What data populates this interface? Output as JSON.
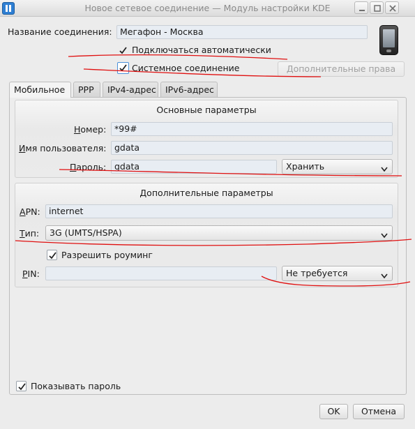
{
  "window": {
    "title": "Новое сетевое соединение — Модуль настройки KDE"
  },
  "connection": {
    "name_label": "Название соединения:",
    "name_value": "Мегафон - Москва",
    "auto_connect_label": "Подключаться автоматически",
    "auto_connect_checked": true,
    "system_connection_label": "Системное соединение",
    "system_connection_checked": true,
    "extra_rights_button": "Дополнительные права"
  },
  "tabs": [
    {
      "label": "Мобильное",
      "active": true
    },
    {
      "label": "PPP",
      "active": false
    },
    {
      "label": "IPv4-адрес",
      "active": false
    },
    {
      "label": "IPv6-адрес",
      "active": false
    }
  ],
  "basic": {
    "title": "Основные параметры",
    "number_label": "Номер:",
    "number_value": "*99#",
    "username_label": "Имя пользователя:",
    "username_value": "gdata",
    "password_label": "Пароль:",
    "password_value": "gdata",
    "password_storage": "Хранить"
  },
  "advanced": {
    "title": "Дополнительные параметры",
    "apn_label": "APN:",
    "apn_value": "internet",
    "type_label": "Тип:",
    "type_value": "3G (UMTS/HSPA)",
    "roaming_label": "Разрешить роуминг",
    "roaming_checked": true,
    "pin_label": "PIN:",
    "pin_value": "",
    "pin_storage": "Не требуется"
  },
  "show_password": {
    "label": "Показывать пароль",
    "checked": true
  },
  "buttons": {
    "ok": "OK",
    "cancel": "Отмена"
  },
  "icons": {
    "app": "kde-network-icon",
    "device": "mobile-phone-icon"
  },
  "colors": {
    "annotation_red": "#e01010",
    "field_background": "#e8edf3"
  }
}
